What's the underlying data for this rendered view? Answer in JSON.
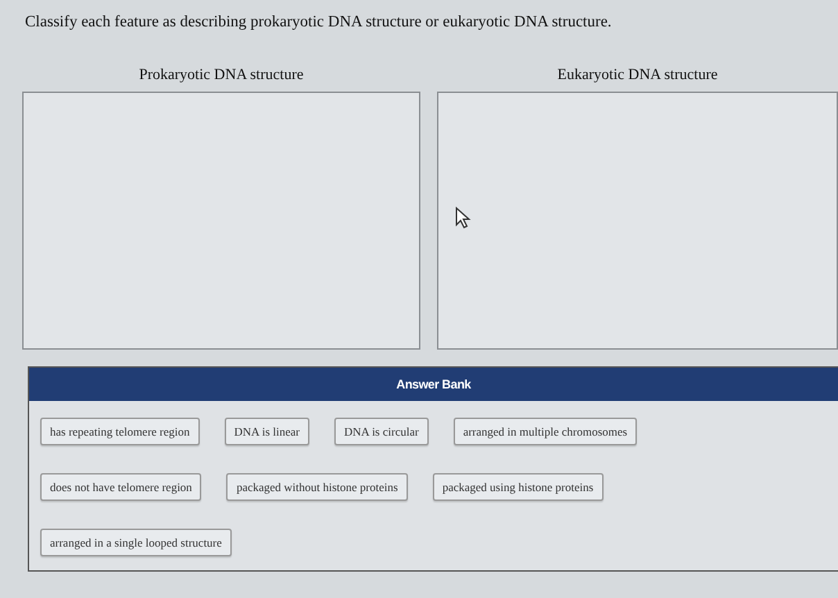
{
  "instruction": "Classify each feature as describing prokaryotic DNA structure or eukaryotic DNA structure.",
  "targets": [
    {
      "label": "Prokaryotic DNA structure"
    },
    {
      "label": "Eukaryotic DNA structure"
    }
  ],
  "answer_bank": {
    "title": "Answer Bank",
    "rows": [
      {
        "items": [
          "has repeating telomere region",
          "DNA is linear",
          "DNA is circular",
          "arranged in multiple chromosomes"
        ]
      },
      {
        "items": [
          "does not have telomere region",
          "packaged without histone proteins",
          "packaged using histone proteins"
        ]
      },
      {
        "items": [
          "arranged in a single looped structure"
        ]
      }
    ]
  }
}
